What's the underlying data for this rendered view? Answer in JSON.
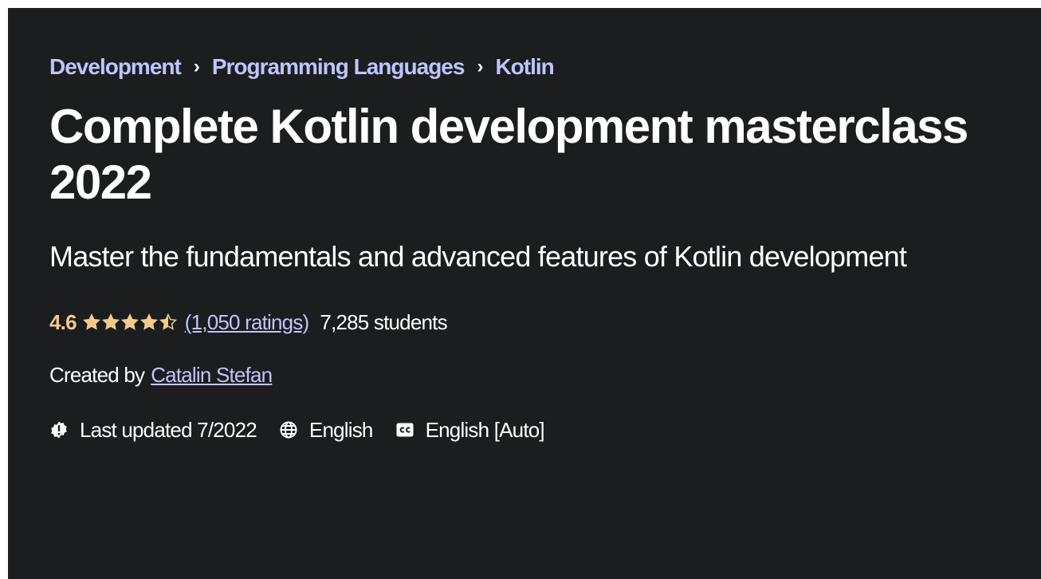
{
  "breadcrumb": {
    "items": [
      "Development",
      "Programming Languages",
      "Kotlin"
    ],
    "separator": "›"
  },
  "course": {
    "title": "Complete Kotlin development masterclass 2022",
    "subtitle": "Master the fundamentals and advanced features of Kotlin development"
  },
  "rating": {
    "value": "4.6",
    "stars_out_of_5": 4.5,
    "ratings_text": "(1,050 ratings)",
    "students_text": "7,285 students"
  },
  "creator": {
    "label": "Created by",
    "name": "Catalin Stefan"
  },
  "meta": {
    "last_updated": "Last updated 7/2022",
    "language": "English",
    "captions": "English [Auto]",
    "icons": [
      "alert-badge-icon",
      "globe-icon",
      "closed-captions-icon"
    ]
  },
  "colors": {
    "background": "#1c1d1f",
    "link": "#c0c4fc",
    "rating": "#f3ca8c",
    "text": "#ffffff"
  }
}
